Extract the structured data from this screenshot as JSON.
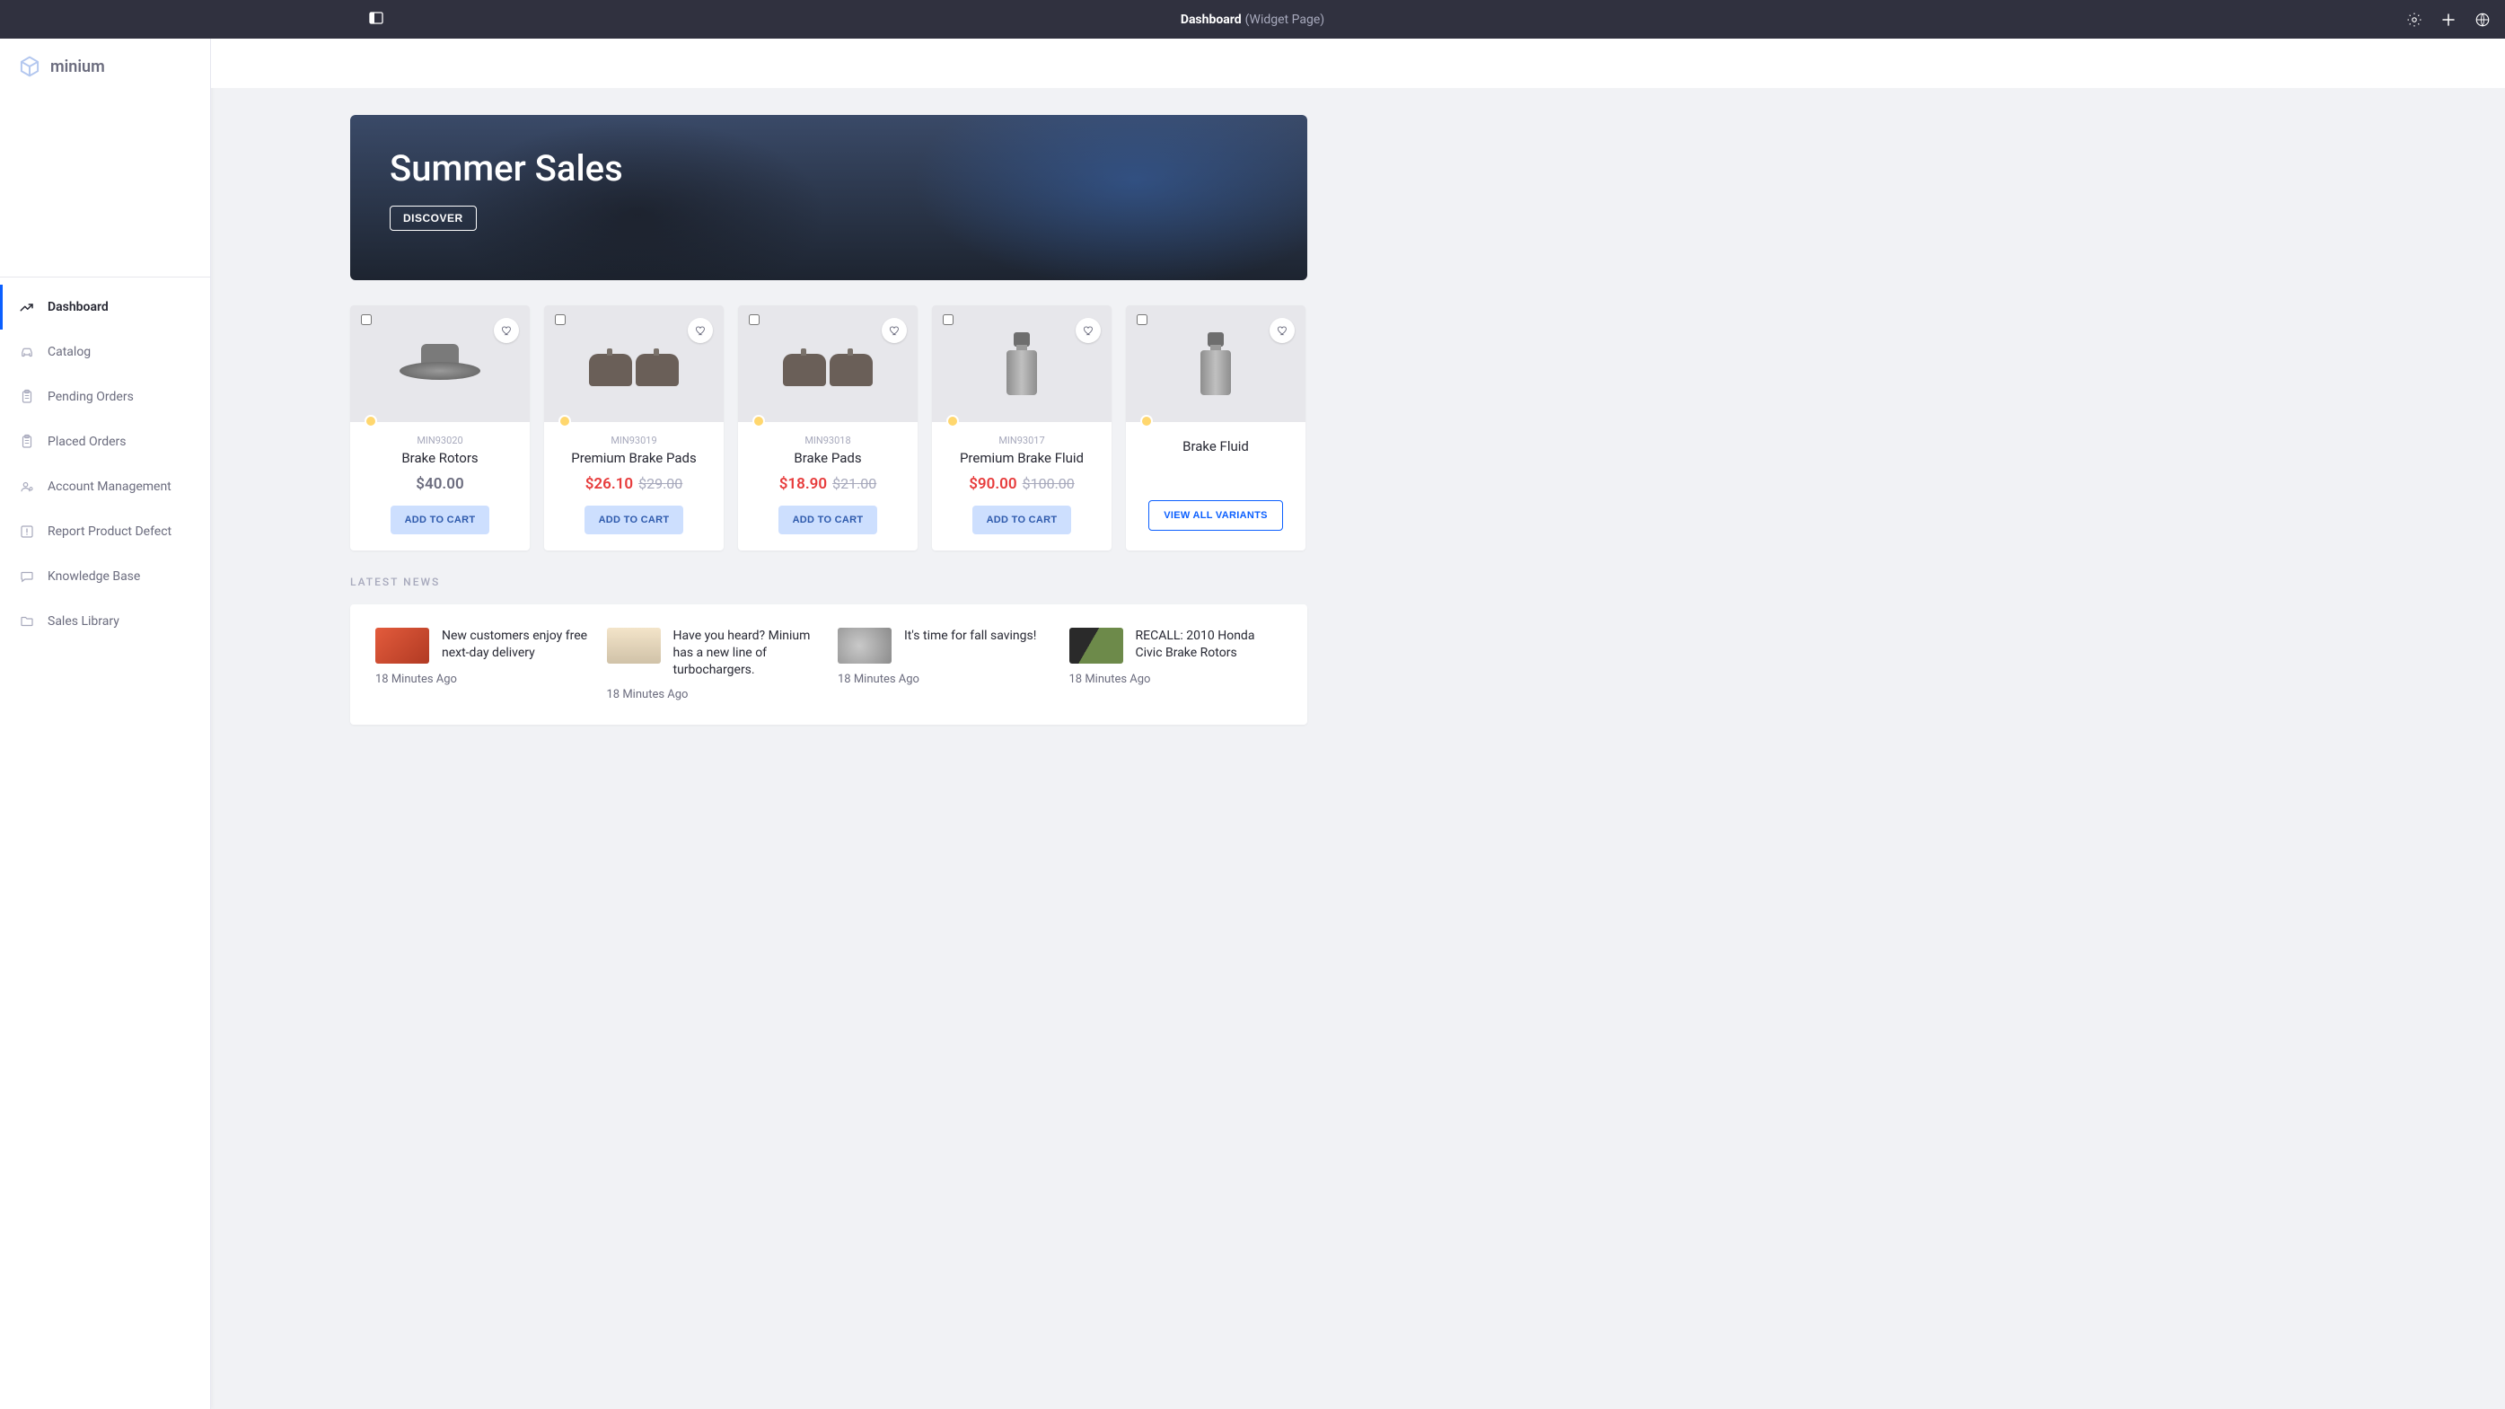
{
  "topbar": {
    "title_bold": "Dashboard",
    "title_muted": "(Widget Page)"
  },
  "brand": {
    "name": "minium"
  },
  "sidebar": {
    "items": [
      {
        "label": "Dashboard",
        "icon": "trend-up-icon",
        "active": true
      },
      {
        "label": "Catalog",
        "icon": "car-icon"
      },
      {
        "label": "Pending Orders",
        "icon": "clipboard-icon"
      },
      {
        "label": "Placed Orders",
        "icon": "clipboard-icon"
      },
      {
        "label": "Account Management",
        "icon": "account-settings-icon"
      },
      {
        "label": "Report Product Defect",
        "icon": "alert-box-icon"
      },
      {
        "label": "Knowledge Base",
        "icon": "chat-icon"
      },
      {
        "label": "Sales Library",
        "icon": "folder-icon"
      }
    ]
  },
  "hero": {
    "title": "Summer Sales",
    "cta": "DISCOVER"
  },
  "products": [
    {
      "sku": "MIN93020",
      "name": "Brake Rotors",
      "price": "$40.00",
      "sale": false,
      "shape": "rotor",
      "cta": "ADD TO CART"
    },
    {
      "sku": "MIN93019",
      "name": "Premium Brake Pads",
      "price": "$26.10",
      "old_price": "$29.00",
      "sale": true,
      "shape": "pads",
      "cta": "ADD TO CART"
    },
    {
      "sku": "MIN93018",
      "name": "Brake Pads",
      "price": "$18.90",
      "old_price": "$21.00",
      "sale": true,
      "shape": "pads",
      "cta": "ADD TO CART"
    },
    {
      "sku": "MIN93017",
      "name": "Premium Brake Fluid",
      "price": "$90.00",
      "old_price": "$100.00",
      "sale": true,
      "shape": "bottle",
      "cta": "ADD TO CART"
    },
    {
      "sku": "",
      "name": "Brake Fluid",
      "price": "",
      "sale": false,
      "shape": "bottle",
      "cta": "VIEW ALL VARIANTS",
      "variant": true
    }
  ],
  "news_section_title": "LATEST NEWS",
  "news": [
    {
      "title": "New customers enjoy free next-day delivery",
      "time": "18 Minutes Ago",
      "thumb": "linear-gradient(135deg,#e35b3c,#b13a23)"
    },
    {
      "title": "Have you heard? Minium has a new line of turbochargers.",
      "time": "18 Minutes Ago",
      "thumb": "linear-gradient(180deg,#f3e4c9,#d0c2a8)"
    },
    {
      "title": "It's time for fall savings!",
      "time": "18 Minutes Ago",
      "thumb": "radial-gradient(circle at 40% 50%, #c9c9c9, #8c8c8c)"
    },
    {
      "title": "RECALL: 2010 Honda Civic Brake Rotors",
      "time": "18 Minutes Ago",
      "thumb": "linear-gradient(120deg,#2a2a2a 40%,#6d8a4a 40%)"
    }
  ]
}
